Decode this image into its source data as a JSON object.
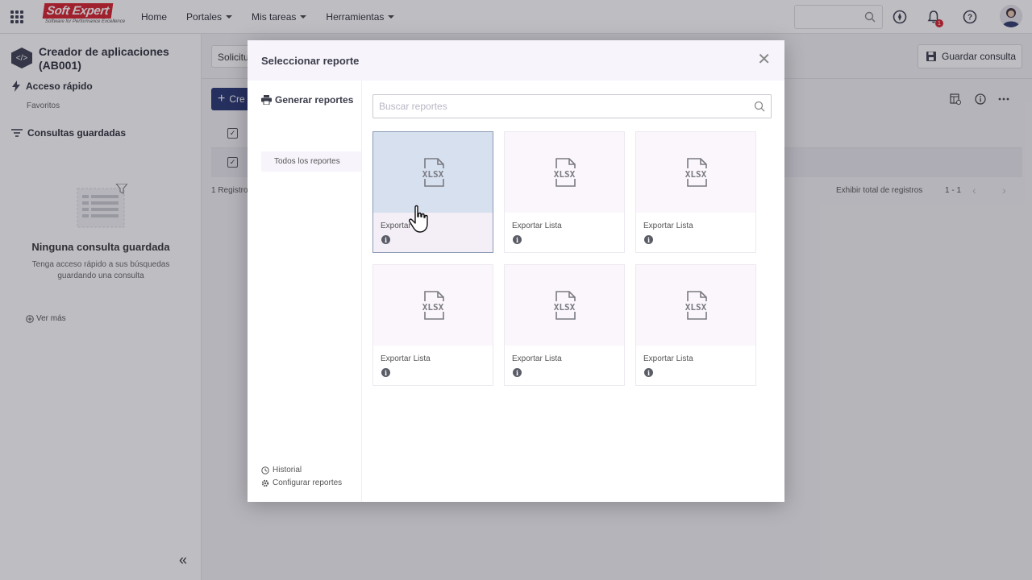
{
  "topbar": {
    "logo_text": "Soft Expert",
    "logo_tagline": "Software for Performance Excellence",
    "nav": [
      "Home",
      "Portales",
      "Mis tareas",
      "Herramientas"
    ],
    "notification_count": "1"
  },
  "sidebar": {
    "app_title": "Creador de aplicaciones (AB001)",
    "quick_access": "Acceso rápido",
    "favorites": "Favoritos",
    "saved_queries": "Consultas guardadas",
    "empty_title": "Ninguna consulta guardada",
    "empty_text": "Tenga acceso rápido a sus búsquedas guardando una consulta",
    "see_more": "Ver más"
  },
  "main": {
    "filter_value": "Solicitu",
    "save_query": "Guardar consulta",
    "create_button": "Cre",
    "record_count": "1 Registro",
    "show_total": "Exhibir total de registros",
    "pager": "1 - 1"
  },
  "modal": {
    "title": "Seleccionar reporte",
    "section": "Generar reportes",
    "all_reports": "Todos los reportes",
    "search_placeholder": "Buscar reportes",
    "history": "Historial",
    "configure": "Configurar reportes",
    "cards": [
      {
        "label": "Exportar",
        "type": "XLSX",
        "selected": true
      },
      {
        "label": "Exportar Lista",
        "type": "XLSX",
        "selected": false
      },
      {
        "label": "Exportar Lista",
        "type": "XLSX",
        "selected": false
      },
      {
        "label": "Exportar Lista",
        "type": "XLSX",
        "selected": false
      },
      {
        "label": "Exportar Lista",
        "type": "XLSX",
        "selected": false
      },
      {
        "label": "Exportar Lista",
        "type": "XLSX",
        "selected": false
      }
    ]
  },
  "colors": {
    "brand_red": "#d5202b",
    "primary_blue": "#263573",
    "selected_card": "#d6e0ee"
  }
}
